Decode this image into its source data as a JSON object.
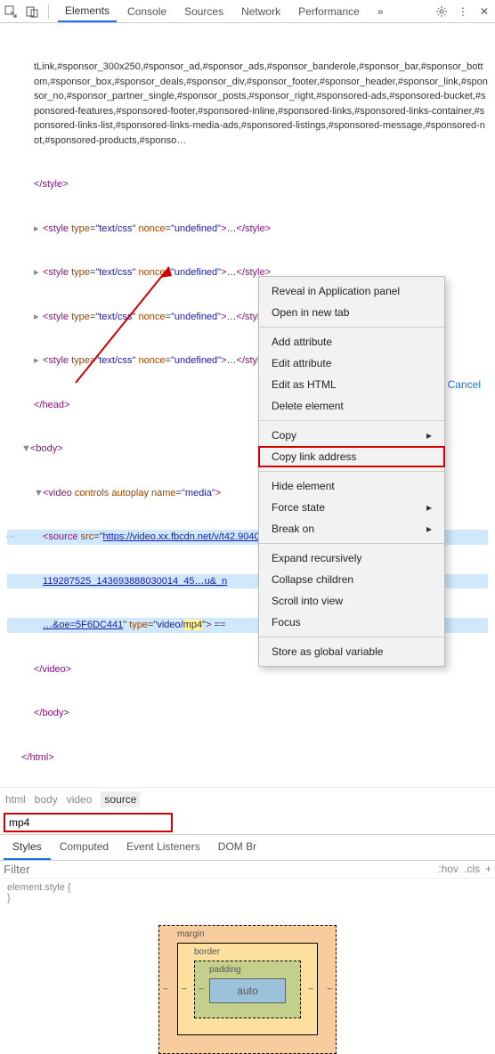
{
  "toolbar": {
    "tabs": [
      "Elements",
      "Console",
      "Sources",
      "Network",
      "Performance"
    ],
    "active_tab": 0
  },
  "dom": {
    "css_block": "tLink,#sponsor_300x250,#sponsor_ad,#sponsor_ads,#sponsor_banderole,#sponsor_bar,#sponsor_bottom,#sponsor_box,#sponsor_deals,#sponsor_div,#sponsor_footer,#sponsor_header,#sponsor_link,#sponsor_no,#sponsor_partner_single,#sponsor_posts,#sponsor_right,#sponsored-ads,#sponsored-bucket,#sponsored-features,#sponsored-footer,#sponsored-inline,#sponsored-links,#sponsored-links-container,#sponsored-links-list,#sponsored-links-media-ads,#sponsored-listings,#sponsored-message,#sponsored-not,#sponsored-products,#sponso…",
    "close_style": "</style>",
    "style_rows": [
      "<style type=\"text/css\" nonce=\"undefined\">…</style>",
      "<style type=\"text/css\" nonce=\"undefined\">…</style>",
      "<style type=\"text/css\" nonce=\"undefined\">…</style>",
      "<style type=\"text/css\" nonce=\"undefined\">…</style>"
    ],
    "close_head": "</head>",
    "body_open": "<body>",
    "video_open": "<video controls autoplay name=\"media\">",
    "source_src_a": "https://video.xx.fbcdn.net/v/t42.9040-2/",
    "source_src_b": "119287525_143693888030014_45…u&_n",
    "source_src_c": "5…",
    "source_tail_a": "…&oe=5F6DC441",
    "source_type_a": "video/",
    "source_type_mp4": "mp4",
    "source_tail_close": " ==",
    "close_video": "</video>",
    "close_body": "</body>",
    "close_html": "</html>"
  },
  "breadcrumb": {
    "items": [
      "html",
      "body",
      "video",
      "source"
    ],
    "active": 3
  },
  "search": {
    "value": "mp4",
    "cancel": "Cancel"
  },
  "styles_tabs": {
    "items": [
      "Styles",
      "Computed",
      "Event Listeners",
      "DOM Br"
    ],
    "active": 0
  },
  "filter": {
    "placeholder": "Filter",
    "hov": ":hov",
    "cls": ".cls",
    "plus": "+"
  },
  "element_style": {
    "open": "element.style {",
    "close": "}"
  },
  "box_model": {
    "margin": "margin",
    "border": "border",
    "padding": "padding",
    "content": "auto",
    "dash": "–"
  },
  "context_menu": {
    "items": [
      {
        "label": "Reveal in Application panel",
        "sep": false
      },
      {
        "label": "Open in new tab",
        "sep": true
      },
      {
        "label": "Add attribute",
        "sep": false
      },
      {
        "label": "Edit attribute",
        "sep": false
      },
      {
        "label": "Edit as HTML",
        "sep": false
      },
      {
        "label": "Delete element",
        "sep": true
      },
      {
        "label": "Copy",
        "sub": true,
        "sep": false
      },
      {
        "label": "Copy link address",
        "highlight": true,
        "sep": true
      },
      {
        "label": "Hide element",
        "sep": false
      },
      {
        "label": "Force state",
        "sub": true,
        "sep": false
      },
      {
        "label": "Break on",
        "sub": true,
        "sep": true
      },
      {
        "label": "Expand recursively",
        "sep": false
      },
      {
        "label": "Collapse children",
        "sep": false
      },
      {
        "label": "Scroll into view",
        "sep": false
      },
      {
        "label": "Focus",
        "sep": true
      },
      {
        "label": "Store as global variable",
        "sep": false
      }
    ]
  }
}
